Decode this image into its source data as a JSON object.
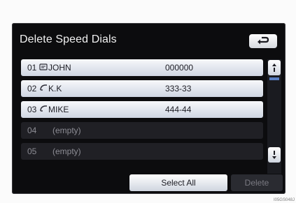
{
  "title": "Delete Speed Dials",
  "icons": {
    "back": "back-arrow-icon",
    "phone": "phone-icon",
    "scroll_up": "arrow-up-icon",
    "scroll_down": "arrow-down-icon"
  },
  "rows": [
    {
      "num": "01",
      "name": "JOHN",
      "number": "000000",
      "state": "filled"
    },
    {
      "num": "02",
      "name": "K.K",
      "number": "333-33",
      "state": "filled"
    },
    {
      "num": "03",
      "name": "MIKE",
      "number": "444-44",
      "state": "filled"
    },
    {
      "num": "04",
      "name": "(empty)",
      "number": "",
      "state": "empty"
    },
    {
      "num": "05",
      "name": "(empty)",
      "number": "",
      "state": "empty"
    }
  ],
  "buttons": {
    "select_all": "Select All",
    "delete": "Delete"
  },
  "image_code": "I05GS048J"
}
